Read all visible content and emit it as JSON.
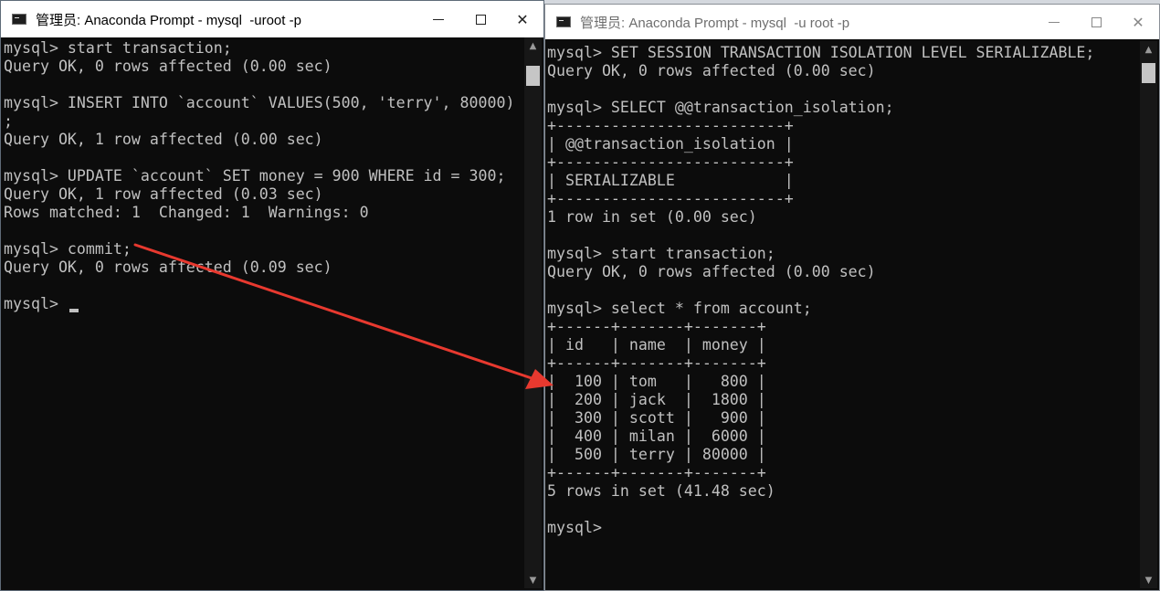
{
  "left_window": {
    "title": "管理员: Anaconda Prompt - mysql  -uroot -p",
    "lines": [
      "mysql> start transaction;",
      "Query OK, 0 rows affected (0.00 sec)",
      "",
      "mysql> INSERT INTO `account` VALUES(500, 'terry', 80000)",
      ";",
      "Query OK, 1 row affected (0.00 sec)",
      "",
      "mysql> UPDATE `account` SET money = 900 WHERE id = 300;",
      "Query OK, 1 row affected (0.03 sec)",
      "Rows matched: 1  Changed: 1  Warnings: 0",
      "",
      "mysql> commit;",
      "Query OK, 0 rows affected (0.09 sec)",
      ""
    ],
    "prompt": "mysql> "
  },
  "right_window": {
    "title": "管理员: Anaconda Prompt - mysql  -u root -p",
    "lines": [
      "mysql> SET SESSION TRANSACTION ISOLATION LEVEL SERIALIZABLE;",
      "Query OK, 0 rows affected (0.00 sec)",
      "",
      "mysql> SELECT @@transaction_isolation;",
      "+-------------------------+",
      "| @@transaction_isolation |",
      "+-------------------------+",
      "| SERIALIZABLE            |",
      "+-------------------------+",
      "1 row in set (0.00 sec)",
      "",
      "mysql> start transaction;",
      "Query OK, 0 rows affected (0.00 sec)",
      "",
      "mysql> select * from account;",
      "+------+-------+-------+",
      "| id   | name  | money |",
      "+------+-------+-------+",
      "|  100 | tom   |   800 |",
      "|  200 | jack  |  1800 |",
      "|  300 | scott |   900 |",
      "|  400 | milan |  6000 |",
      "|  500 | terry | 80000 |",
      "+------+-------+-------+",
      "5 rows in set (41.48 sec)",
      "",
      "mysql>"
    ]
  },
  "colors": {
    "terminal_bg": "#0c0c0c",
    "terminal_text": "#c0c0c0",
    "annotation_arrow": "#e8392f"
  },
  "icons": {
    "title_icon": "console-window-icon",
    "minimize": "minimize-icon",
    "maximize": "maximize-icon",
    "close": "close-icon",
    "scroll_up": "scroll-up-arrow-icon",
    "scroll_down": "scroll-down-arrow-icon"
  }
}
